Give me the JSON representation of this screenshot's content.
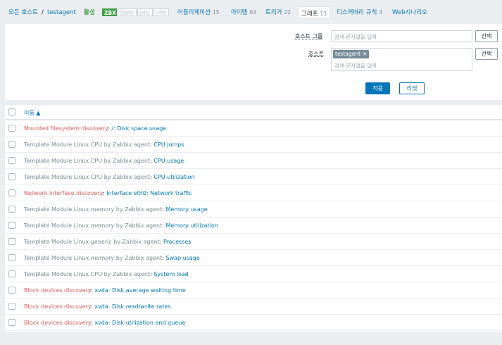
{
  "nav": {
    "all_hosts": "모든 호스트",
    "separator": "/",
    "host": "testagent",
    "status": "활성",
    "badges": [
      "ZBX",
      "SNMP",
      "JMX",
      "IPMI"
    ],
    "apps": {
      "label": "어플리케이션",
      "count": "15"
    },
    "items": {
      "label": "아이템",
      "count": "63"
    },
    "triggers": {
      "label": "트리거",
      "count": "22"
    },
    "graphs": {
      "label": "그래프",
      "count": "13"
    },
    "discovery": {
      "label": "디스커버리 규칙",
      "count": "4"
    },
    "web": {
      "label": "Web시나리오"
    }
  },
  "filter": {
    "host_group_label": "호스트 그룹",
    "host_group_placeholder": "검색 문자열을 입력",
    "host_label": "호스트",
    "host_tag": "testagent",
    "host_placeholder": "검색 문자열을 입력",
    "select_label": "선택",
    "apply_label": "적용",
    "reset_label": "리셋"
  },
  "table": {
    "header_name": "이름 ▲",
    "rows": [
      {
        "prefix": "Mounted filesystem discovery",
        "prefix_style": "red",
        "name": "/: Disk space usage"
      },
      {
        "prefix": "Template Module Linux CPU by Zabbix agent",
        "prefix_style": "gray",
        "name": "CPU jumps"
      },
      {
        "prefix": "Template Module Linux CPU by Zabbix agent",
        "prefix_style": "gray",
        "name": "CPU usage"
      },
      {
        "prefix": "Template Module Linux CPU by Zabbix agent",
        "prefix_style": "gray",
        "name": "CPU utilization"
      },
      {
        "prefix": "Network interface discovery",
        "prefix_style": "red",
        "name": "Interface eth0: Network traffic"
      },
      {
        "prefix": "Template Module Linux memory by Zabbix agent",
        "prefix_style": "gray",
        "name": "Memory usage"
      },
      {
        "prefix": "Template Module Linux memory by Zabbix agent",
        "prefix_style": "gray",
        "name": "Memory utilization"
      },
      {
        "prefix": "Template Module Linux generic by Zabbix agent",
        "prefix_style": "gray",
        "name": "Processes"
      },
      {
        "prefix": "Template Module Linux memory by Zabbix agent",
        "prefix_style": "gray",
        "name": "Swap usage"
      },
      {
        "prefix": "Template Module Linux CPU by Zabbix agent",
        "prefix_style": "gray",
        "name": "System load"
      },
      {
        "prefix": "Block devices discovery",
        "prefix_style": "red",
        "name": "xvda: Disk average waiting time"
      },
      {
        "prefix": "Block devices discovery",
        "prefix_style": "red",
        "name": "xvda: Disk read/write rates"
      },
      {
        "prefix": "Block devices discovery",
        "prefix_style": "red",
        "name": "xvda: Disk utilization and queue"
      }
    ]
  }
}
